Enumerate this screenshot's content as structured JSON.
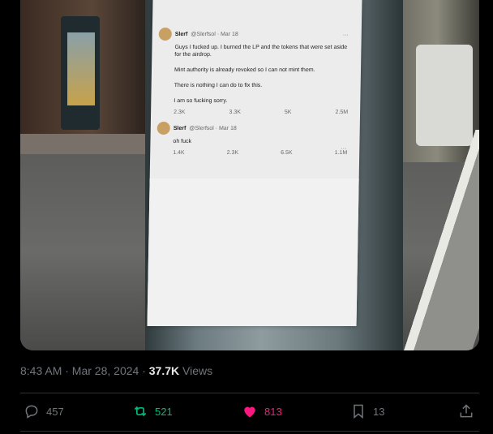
{
  "media": {
    "tweets": [
      {
        "name": "Slerf",
        "handle": "@Slerfsol · Mar 18",
        "lines": [
          "Guys I fucked up. I burned the LP and the tokens that were set aside for the airdrop.",
          "Mint authority is already revoked so I can not mint them.",
          "There is nothing I can do to fix this.",
          "I am so fucking sorry."
        ],
        "stats": [
          "2.3K",
          "3.3K",
          "5K",
          "2.5M"
        ]
      },
      {
        "name": "Slerf",
        "handle": "@Slerfsol · Mar 18",
        "lines": [
          "oh fuck"
        ],
        "stats": [
          "1.4K",
          "2.3K",
          "6.5K",
          "1.1M"
        ]
      }
    ]
  },
  "post": {
    "time": "8:43 AM · Mar 28, 2024 · ",
    "views_count": "37.7K",
    "views_label": " Views"
  },
  "actions": {
    "replies": "457",
    "reposts": "521",
    "likes": "813",
    "bookmarks": "13"
  },
  "colors": {
    "repost": "#00ba7c",
    "like": "#f91880",
    "muted": "#71767b"
  },
  "icons": [
    "reply-icon",
    "repost-icon",
    "like-icon",
    "bookmark-icon",
    "share-icon"
  ]
}
